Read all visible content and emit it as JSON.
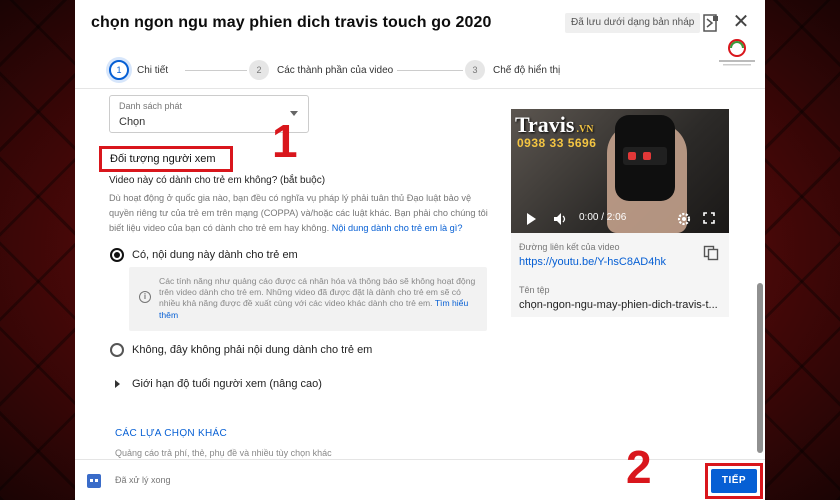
{
  "dialog": {
    "title": "chọn ngon ngu may phien dich travis touch go 2020",
    "draft_status": "Đã lưu dưới dạng bản nháp",
    "brand_logo": "logo-badge"
  },
  "stepper": {
    "steps": [
      {
        "number": "1",
        "label": "Chi tiết"
      },
      {
        "number": "2",
        "label": "Các thành phần của video"
      },
      {
        "number": "3",
        "label": "Chế độ hiển thị"
      }
    ]
  },
  "playlist": {
    "label": "Danh sách phát",
    "value": "Chọn"
  },
  "audience": {
    "heading": "Đối tượng người xem",
    "question": "Video này có dành cho trẻ em không? (bắt buộc)",
    "description": "Dù hoạt động ở quốc gia nào, bạn đều có nghĩa vụ pháp lý phải tuân thủ Đạo luật bảo vệ quyền riêng tư của trẻ em trên mạng (COPPA) và/hoặc các luật khác. Bạn phải cho chúng tôi biết liệu video của bạn có dành cho trẻ em hay không.",
    "description_link": "Nội dung dành cho trẻ em là gì?",
    "option_yes": "Có, nội dung này dành cho trẻ em",
    "info_text": "Các tính năng như quảng cáo được cá nhân hóa và thông báo sẽ không hoạt động trên video dành cho trẻ em. Những video đã được đặt là dành cho trẻ em sẽ có nhiều khả năng được đề xuất cùng với các video khác dành cho trẻ em.",
    "info_link": "Tìm hiểu thêm",
    "option_no": "Không, đây không phải nội dung dành cho trẻ em",
    "age_restriction": "Giới hạn độ tuổi người xem (nâng cao)"
  },
  "more_options": {
    "title": "CÁC LỰA CHỌN KHÁC",
    "description": "Quảng cáo trả phí, thẻ, phụ đề và nhiều tùy chọn khác"
  },
  "preview": {
    "watermark": "Travis",
    "watermark_suffix": ".VN",
    "watermark_phone": "0938 33 5696",
    "time": "0:00 / 2:06",
    "link_label": "Đường liên kết của video",
    "link_value": "https://youtu.be/Y-hsC8AD4hk",
    "file_label": "Tên tệp",
    "file_value": "chọn-ngon-ngu-may-phien-dich-travis-t..."
  },
  "footer": {
    "status": "Đã xử lý xong",
    "next_button": "TIẾP"
  },
  "callouts": {
    "one": "1",
    "two": "2"
  },
  "colors": {
    "accent": "#065fd4",
    "highlight": "#d9161c"
  }
}
